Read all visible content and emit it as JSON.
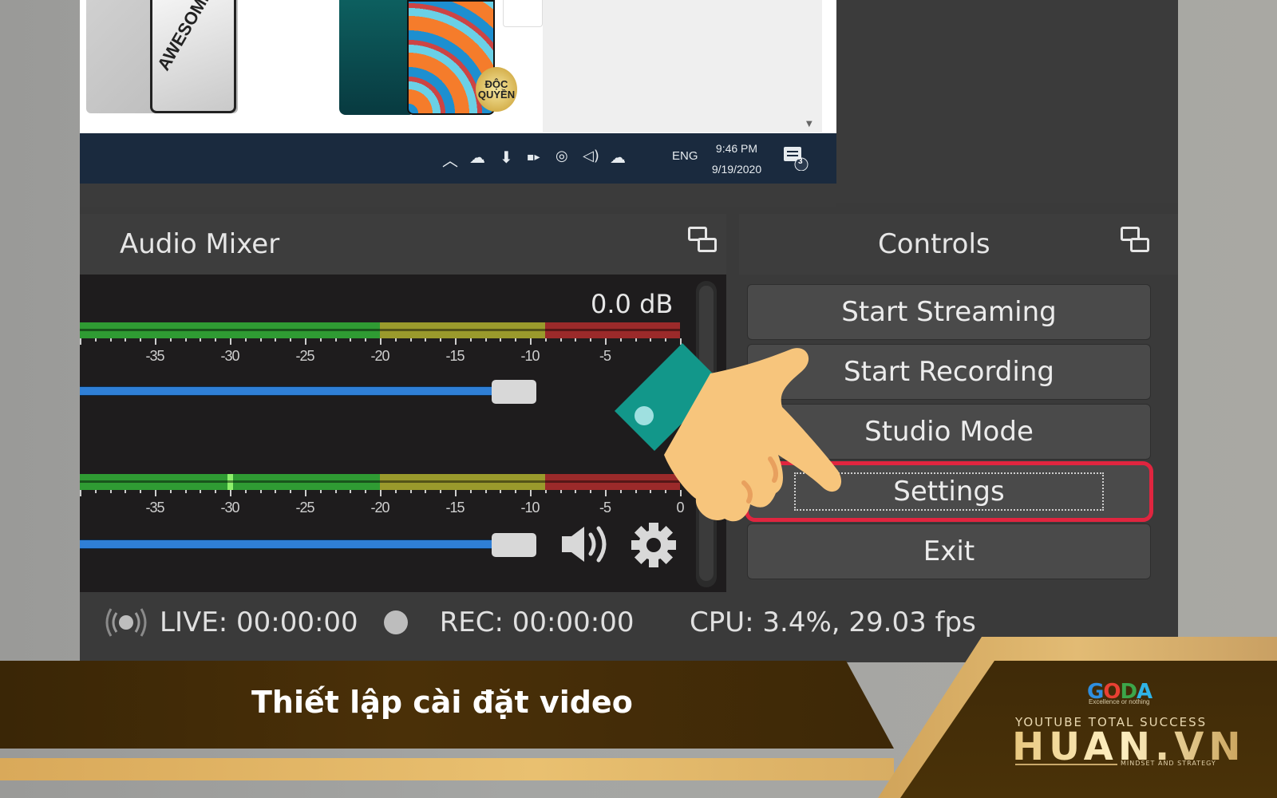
{
  "preview": {
    "product_1_text": "AWESOME",
    "product_2_badge": "ĐỘC QUYỀN"
  },
  "taskbar": {
    "language": "ENG",
    "time": "9:46 PM",
    "date": "9/19/2020",
    "notification_count": "3",
    "icons": [
      "chevron-up-icon",
      "onedrive-icon",
      "usb-icon",
      "battery-icon",
      "network-icon",
      "volume-icon",
      "cloud-icon"
    ]
  },
  "audio_mixer": {
    "title": "Audio Mixer",
    "volume_readout": "0.0 dB",
    "scale_labels": [
      "-35",
      "-30",
      "-25",
      "-20",
      "-15",
      "-10",
      "-5",
      "0"
    ],
    "scale_min_db": -40,
    "scale_max_db": 0,
    "channels": [
      {
        "fader_level": 0.86,
        "peak_db": null
      },
      {
        "fader_level": 0.86,
        "peak_db": -30
      }
    ],
    "zone_colors": {
      "green": "#2f9b33",
      "yellow": "#9a9a2c",
      "red": "#9b2a2a"
    },
    "zone_bounds_db": {
      "yellow_start": -20,
      "red_start": -9
    }
  },
  "controls": {
    "title": "Controls",
    "buttons": [
      {
        "label": "Start Streaming",
        "highlighted": false
      },
      {
        "label": "Start Recording",
        "highlighted": false
      },
      {
        "label": "Studio Mode",
        "highlighted": false
      },
      {
        "label": "Settings",
        "highlighted": true
      },
      {
        "label": "Exit",
        "highlighted": false
      }
    ],
    "highlight_color": "#e0253f"
  },
  "status_bar": {
    "live": "LIVE: 00:00:00",
    "rec": "REC: 00:00:00",
    "cpu": "CPU: 3.4%, 29.03 fps"
  },
  "banner": {
    "caption": "Thiết lập cài đặt video",
    "logo_goda": "GODA",
    "logo_goda_tagline": "Excellence or nothing",
    "logo_tagline_top": "YOUTUBE TOTAL SUCCESS",
    "logo_brand": "HUAN.VN",
    "logo_tagline_bottom": "MINDSET AND STRATEGY"
  }
}
